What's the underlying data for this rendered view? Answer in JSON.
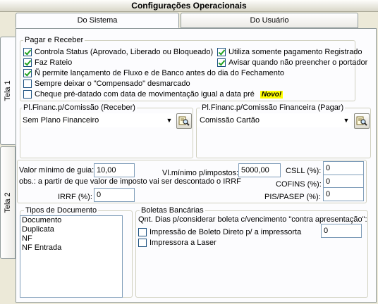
{
  "window": {
    "title": "Configurações Operacionais"
  },
  "top_tabs": [
    {
      "label": "Do Sistema"
    },
    {
      "label": "Do Usuário"
    }
  ],
  "side_tabs": [
    {
      "label": "Tela 1"
    },
    {
      "label": "Tela 2"
    }
  ],
  "pagar_receber": {
    "title": "Pagar e Receber",
    "options": [
      {
        "label": "Controla Status  (Aprovado, Liberado ou Bloqueado)",
        "checked": true
      },
      {
        "label": "Utiliza somente pagamento Registrado",
        "checked": true
      },
      {
        "label": "Faz Rateio",
        "checked": true
      },
      {
        "label": "Avisar quando não preencher o portador",
        "checked": true
      },
      {
        "label": "Ñ permite lançamento de Fluxo e de Banco antes do dia do Fechamento",
        "checked": true
      },
      {
        "label": "Sempre deixar o \"Compensado\" desmarcado",
        "checked": false
      },
      {
        "label": "Cheque pré-datado com data de movimentação igual a data pré",
        "checked": false
      }
    ],
    "new_badge": "Novo!"
  },
  "plano_receber": {
    "title": "Pl.Financ.p/Comissão (Receber)",
    "selected": "Sem Plano Financeiro"
  },
  "plano_pagar": {
    "title": "Pl.Financ.p/Comissão Financeira (Pagar)",
    "selected": "Comissão Cartão"
  },
  "impostos": {
    "valor_minimo_label": "Valor mínimo de guia:",
    "valor_minimo": "10,00",
    "vl_minimo_label": "Vl.mínimo p/impostos:",
    "vl_minimo": "5000,00",
    "obs": "obs.: a partir de que valor de imposto vai ser descontado o IRRF",
    "irrf_label": "IRRF (%):",
    "irrf": "0",
    "csll_label": "CSLL (%):",
    "csll": "0",
    "cofins_label": "COFINS (%):",
    "cofins": "0",
    "pis_label": "PIS/PASEP (%):",
    "pis": "0"
  },
  "tipos_documento": {
    "title": "Tipos de Documento",
    "items": [
      "Documento",
      "Duplicata",
      "NF",
      "NF Entrada"
    ]
  },
  "boletas": {
    "title": "Boletas Bancárias",
    "dias_label": "Qnt. Dias p/considerar boleta c/vencimento \"contra apresentação\":",
    "dias": "0",
    "options": [
      {
        "label": "Impressão de Boleto Direto p/ a impressorta",
        "checked": false
      },
      {
        "label": "Impressora a Laser",
        "checked": false
      }
    ]
  }
}
